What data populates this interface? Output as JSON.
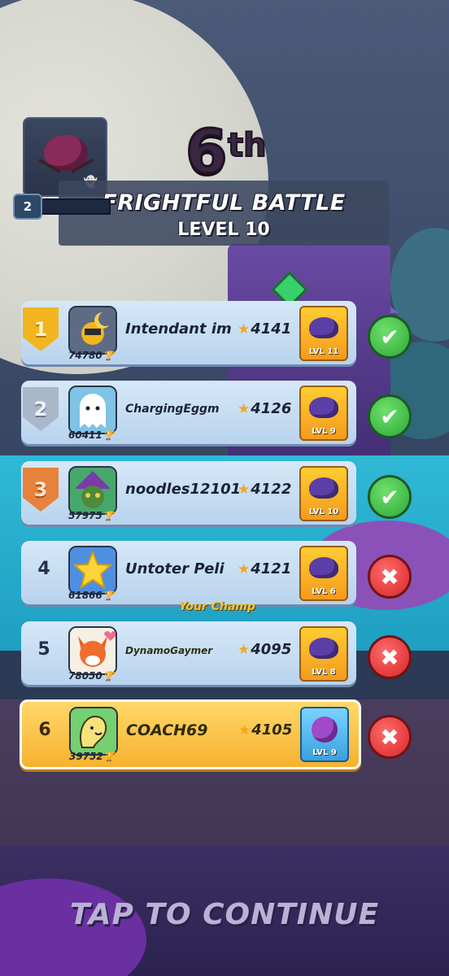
{
  "header": {
    "mission_level_badge": "2",
    "placement_number": "6",
    "placement_suffix": "th",
    "battle_title": "FRIGHTFUL BATTLE",
    "battle_level": "LEVEL 10"
  },
  "leaderboard": [
    {
      "rank": "1",
      "rank_style": "gold",
      "trophies": "74780",
      "name": "Intendant im",
      "score": "4141",
      "pet_level": "LVL 11",
      "result": "win"
    },
    {
      "rank": "2",
      "rank_style": "silver",
      "trophies": "60411",
      "name": "ChargingEggm",
      "score": "4126",
      "pet_level": "LVL 9",
      "result": "win"
    },
    {
      "rank": "3",
      "rank_style": "bronze",
      "trophies": "57975",
      "name": "noodles12101",
      "score": "4122",
      "pet_level": "LVL 10",
      "result": "win"
    },
    {
      "rank": "4",
      "rank_style": "plain",
      "trophies": "61866",
      "name": "Untoter Peli",
      "score": "4121",
      "pet_level": "LVL 6",
      "result": "lose"
    },
    {
      "rank": "5",
      "rank_style": "plain",
      "trophies": "78050",
      "name": "DynamoGaymer",
      "score": "4095",
      "pet_level": "LVL 8",
      "result": "lose"
    },
    {
      "rank": "6",
      "rank_style": "plain",
      "trophies": "39752",
      "name": "COACH69",
      "score": "4105",
      "pet_level": "LVL 9",
      "result": "lose",
      "is_self": true
    }
  ],
  "your_champ_label": "Your Champ",
  "footer": {
    "tap_to_continue": "TAP TO CONTINUE"
  },
  "colors": {
    "gold_rank": "#f2b51f",
    "silver_rank": "#a9b7c9",
    "bronze_rank": "#e6823c",
    "win": "#2ea83a",
    "lose": "#d8262a",
    "self_row": "#f7b12f"
  },
  "icons": {
    "trophy": "trophy-icon",
    "star": "star-icon",
    "win": "check-icon",
    "lose": "cross-icon"
  }
}
